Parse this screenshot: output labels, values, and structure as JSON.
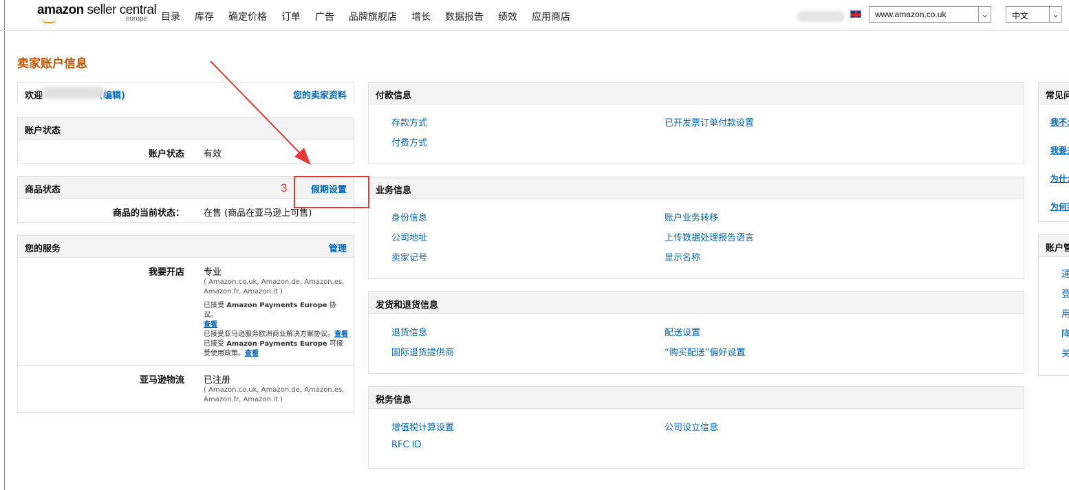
{
  "header": {
    "logo_main": "amazon",
    "logo_sub_brand": " seller central",
    "logo_region": "europe",
    "nav": [
      "目录",
      "库存",
      "确定价格",
      "订单",
      "广告",
      "品牌旗舰店",
      "增长",
      "数据报告",
      "绩效",
      "应用商店"
    ],
    "site_select": "www.amazon.co.uk",
    "lang_select": "中文"
  },
  "page_title": "卖家账户信息",
  "welcome": {
    "label": "欢迎",
    "edit": "(编辑)",
    "profile_link": "您的卖家资料"
  },
  "account_status": {
    "title": "账户状态",
    "label": "账户状态",
    "value": "有效"
  },
  "listing_status": {
    "title": "商品状态",
    "action": "假期设置",
    "label": "商品的当前状态：",
    "value": "在售 (商品在亚马逊上可售)"
  },
  "services": {
    "title": "您的服务",
    "action": "管理",
    "items": [
      {
        "label": "我要开店",
        "value": "专业",
        "markets": "( Amazon.co.uk, Amazon.de, Amazon.es, Amazon.fr, Amazon.it )",
        "note1_pre": "已接受 ",
        "note1_bold": "Amazon Payments Europe",
        "note1_post": " 协议。",
        "note1_link": "查看",
        "note2_pre": "已接受亚马逊服务欧洲商业解决方案协议。",
        "note2_link": "查看",
        "note3_pre": "已接受 ",
        "note3_bold": "Amazon Payments Europe",
        "note3_post": " 可接受使用政策。",
        "note3_link": "查看"
      },
      {
        "label": "亚马逊物流",
        "value": "已注册",
        "markets": "( Amazon.co.uk, Amazon.de, Amazon.es, Amazon.fr, Amazon.it )"
      }
    ]
  },
  "payment_info": {
    "title": "付款信息",
    "links": [
      "存款方式",
      "已开发票订单付款设置",
      "付费方式"
    ]
  },
  "business_info": {
    "title": "业务信息",
    "links": [
      "身份信息",
      "账户业务转移",
      "公司地址",
      "上传数据处理报告语言",
      "卖家记号",
      "显示名称"
    ]
  },
  "shipping_info": {
    "title": "发货和退货信息",
    "links": [
      "退货信息",
      "配送设置",
      "国际退货提供商",
      "“购买配送”偏好设置"
    ]
  },
  "tax_info": {
    "title": "税务信息",
    "links": [
      "增值税计算设置",
      "公司设立信息",
      "RFC ID"
    ]
  },
  "faq": {
    "title": "常见问",
    "links": [
      "我不么",
      "我要去",
      "为什么",
      "为何我"
    ]
  },
  "account_mgmt": {
    "title": "账户管",
    "links": [
      "通",
      "登",
      "用",
      "降",
      "关"
    ]
  },
  "annotation": {
    "step_number": "3"
  }
}
